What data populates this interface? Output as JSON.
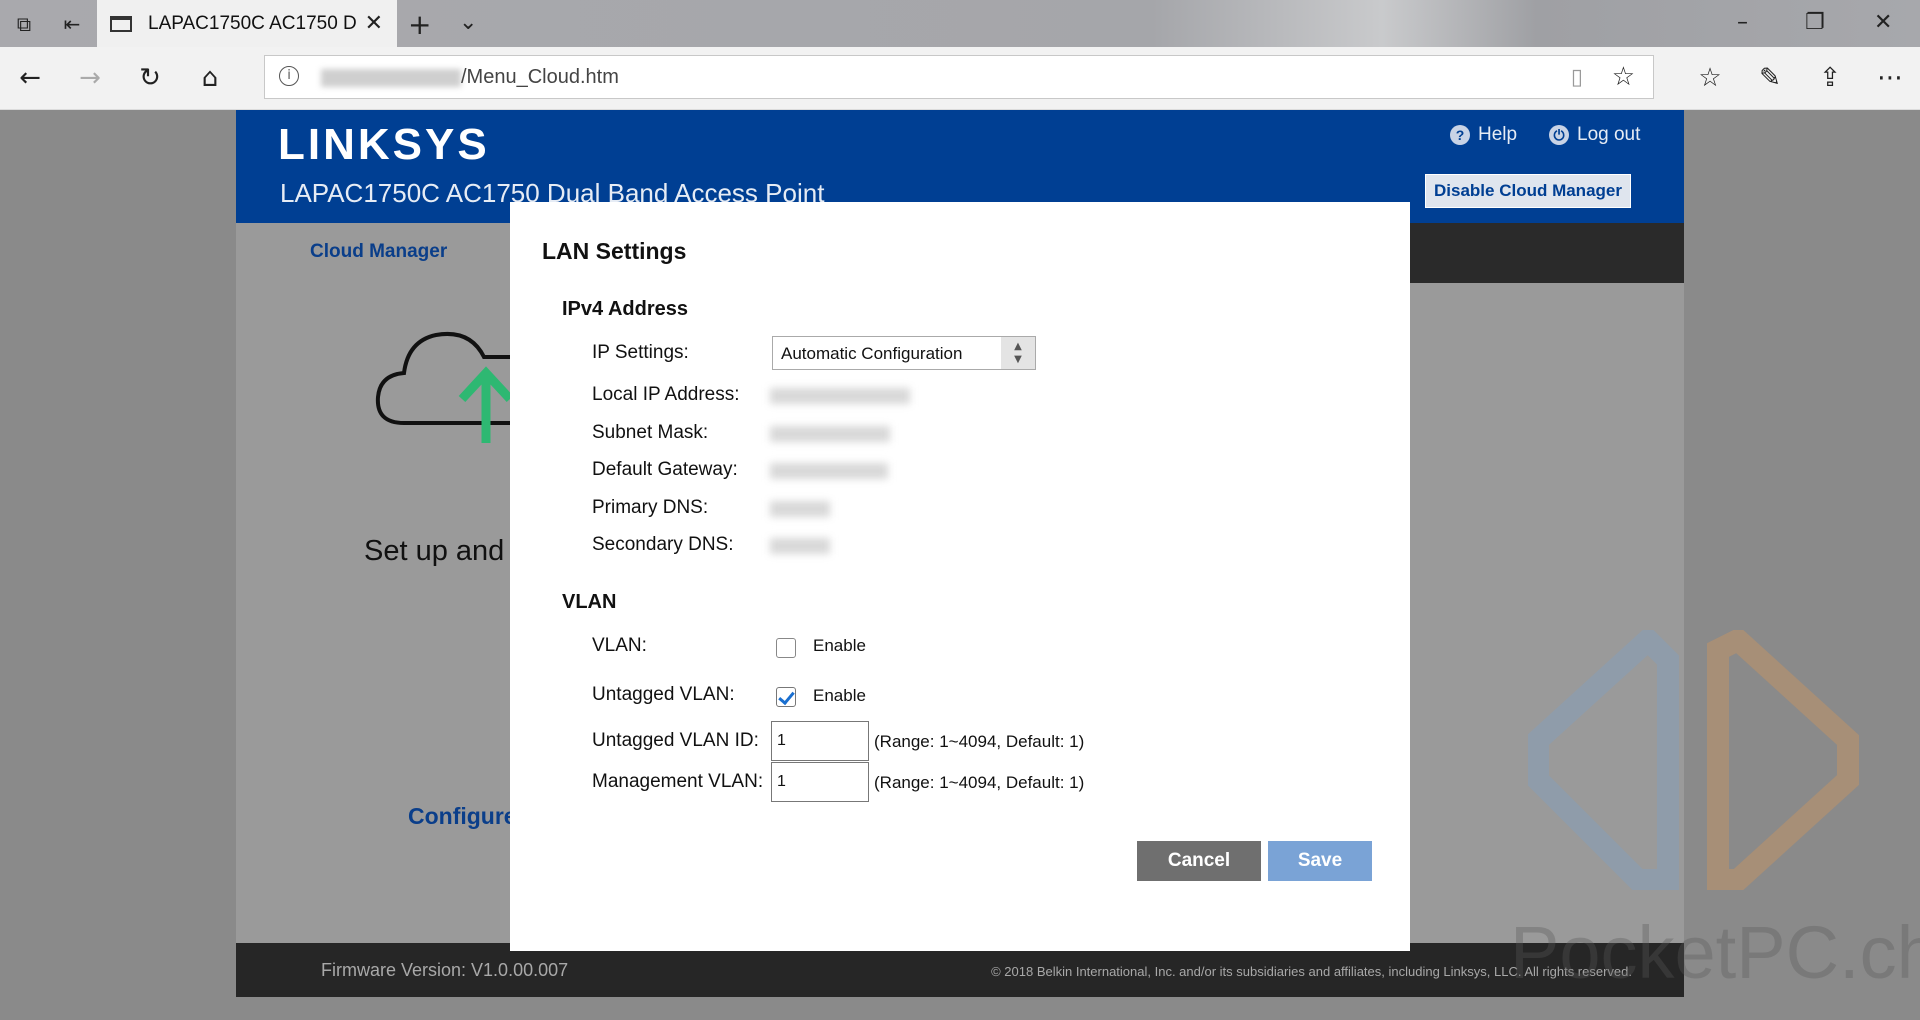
{
  "browser": {
    "tab_title": "LAPAC1750C AC1750 D",
    "url_path": "/Menu_Cloud.htm"
  },
  "header": {
    "logo": "LINKSYS",
    "device_title": "LAPAC1750C AC1750 Dual Band Access Point",
    "help": "Help",
    "logout": "Log out",
    "disable_cloud": "Disable Cloud Manager"
  },
  "menu": {
    "cloud_manager": "Cloud Manager"
  },
  "content": {
    "setup_text": "Set up and",
    "configure_text": "Configure"
  },
  "footer": {
    "firmware": "Firmware Version: V1.0.00.007",
    "copyright": "© 2018 Belkin International, Inc. and/or its subsidiaries and affiliates, including Linksys, LLC. All rights reserved."
  },
  "modal": {
    "title": "LAN Settings",
    "ipv4_heading": "IPv4 Address",
    "ip_settings_label": "IP Settings:",
    "ip_settings_value": "Automatic Configuration",
    "local_ip_label": "Local IP Address:",
    "subnet_label": "Subnet Mask:",
    "gateway_label": "Default Gateway:",
    "primary_dns_label": "Primary DNS:",
    "secondary_dns_label": "Secondary DNS:",
    "vlan_heading": "VLAN",
    "vlan_label": "VLAN:",
    "vlan_enable": "Enable",
    "vlan_checked": false,
    "untagged_vlan_label": "Untagged VLAN:",
    "untagged_vlan_enable": "Enable",
    "untagged_vlan_checked": true,
    "untagged_vlan_id_label": "Untagged VLAN ID:",
    "untagged_vlan_id_value": "1",
    "untagged_vlan_id_range": "(Range: 1~4094, Default: 1)",
    "mgmt_vlan_label": "Management VLAN:",
    "mgmt_vlan_value": "1",
    "mgmt_vlan_range": "(Range: 1~4094, Default: 1)",
    "cancel": "Cancel",
    "save": "Save"
  },
  "watermark": "PocketPC.ch",
  "colors": {
    "brand_blue": "#003f93",
    "save_blue": "#7aa3d6",
    "cancel_gray": "#6f6f6f",
    "cloud_arrow_green": "#2eb872"
  }
}
